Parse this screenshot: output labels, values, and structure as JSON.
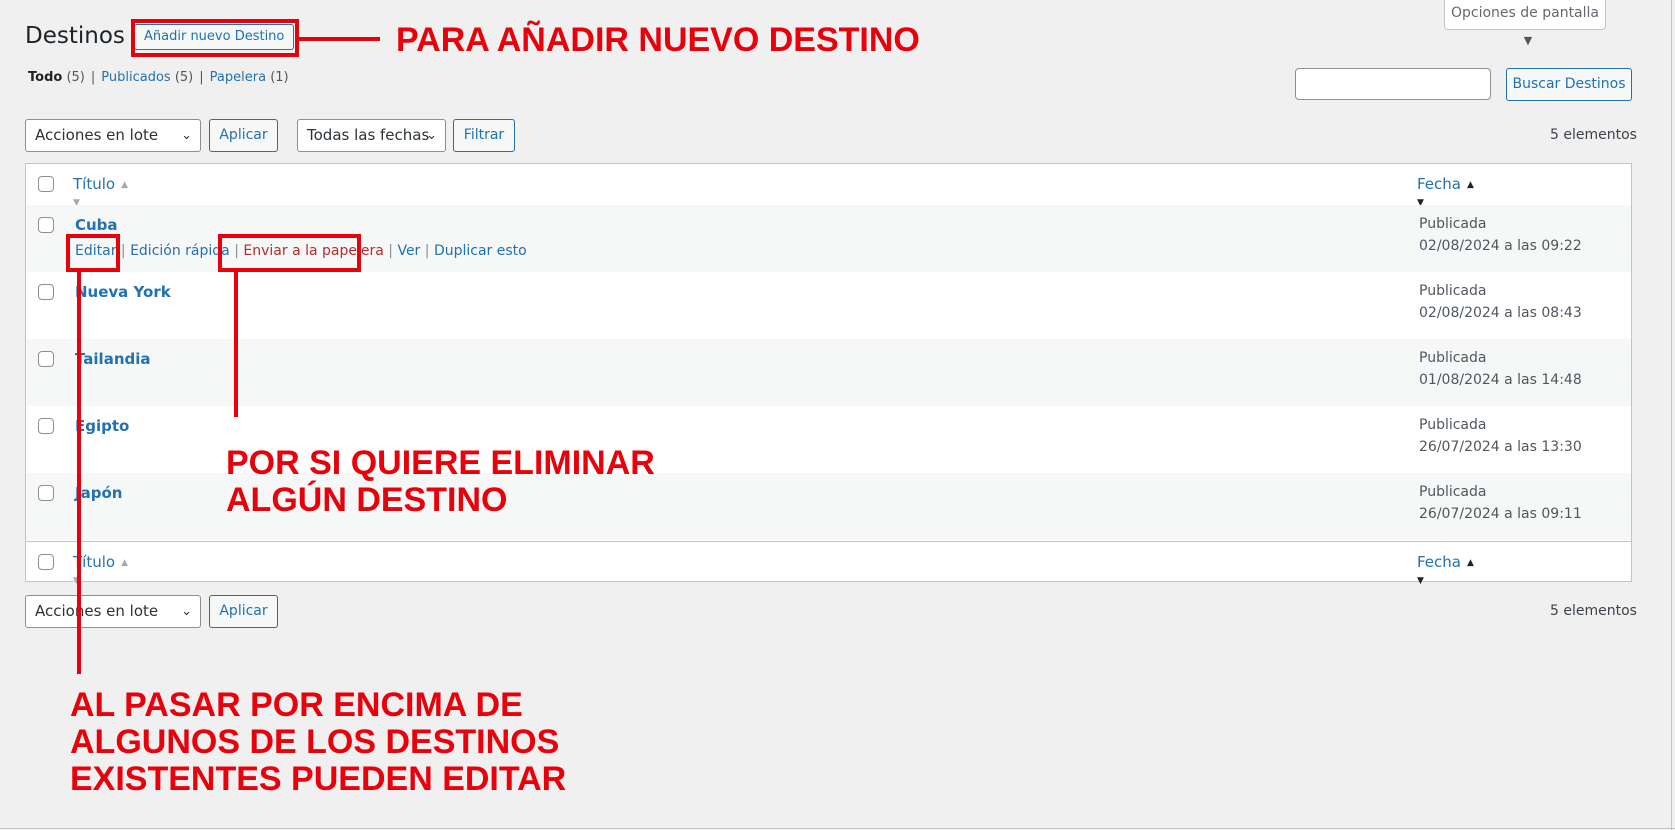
{
  "header": {
    "title": "Destinos",
    "add_new": "Añadir nuevo Destino",
    "screen_options": "Opciones de pantalla",
    "screen_options_caret": "▼"
  },
  "views": [
    {
      "label": "Todo",
      "count": "(5)"
    },
    {
      "label": "Publicados",
      "count": "(5)"
    },
    {
      "label": "Papelera",
      "count": "(1)"
    }
  ],
  "search": {
    "value": "",
    "button": "Buscar Destinos"
  },
  "top_nav": {
    "bulk_select": "Acciones en lote",
    "apply": "Aplicar",
    "dates_select": "Todas las fechas",
    "filter": "Filtrar",
    "count": "5 elementos"
  },
  "bottom_nav": {
    "bulk_select": "Acciones en lote",
    "apply": "Aplicar",
    "count": "5 elementos"
  },
  "table": {
    "col_title": "Título",
    "col_date": "Fecha",
    "row_actions": {
      "edit": "Editar",
      "quick_edit": "Edición rápida",
      "trash": "Enviar a la papelera",
      "view": "Ver",
      "duplicate": "Duplicar esto",
      "separator": "|"
    },
    "rows": [
      {
        "title": "Cuba",
        "status": "Publicada",
        "date": "02/08/2024 a las 09:22"
      },
      {
        "title": "Nueva York",
        "status": "Publicada",
        "date": "02/08/2024 a las 08:43"
      },
      {
        "title": "Tailandia",
        "status": "Publicada",
        "date": "01/08/2024 a las 14:48"
      },
      {
        "title": "Egipto",
        "status": "Publicada",
        "date": "26/07/2024 a las 13:30"
      },
      {
        "title": "Japón",
        "status": "Publicada",
        "date": "26/07/2024 a las 09:11"
      }
    ]
  },
  "annotations": {
    "add_new": "PARA AÑADIR NUEVO DESTINO",
    "trash": [
      "POR SI QUIERE ELIMINAR",
      "ALGÚN DESTINO"
    ],
    "edit": [
      "AL PASAR POR ENCIMA DE",
      "ALGUNOS DE LOS DESTINOS",
      "EXISTENTES PUEDEN EDITAR"
    ],
    "color": "#e8000b"
  }
}
